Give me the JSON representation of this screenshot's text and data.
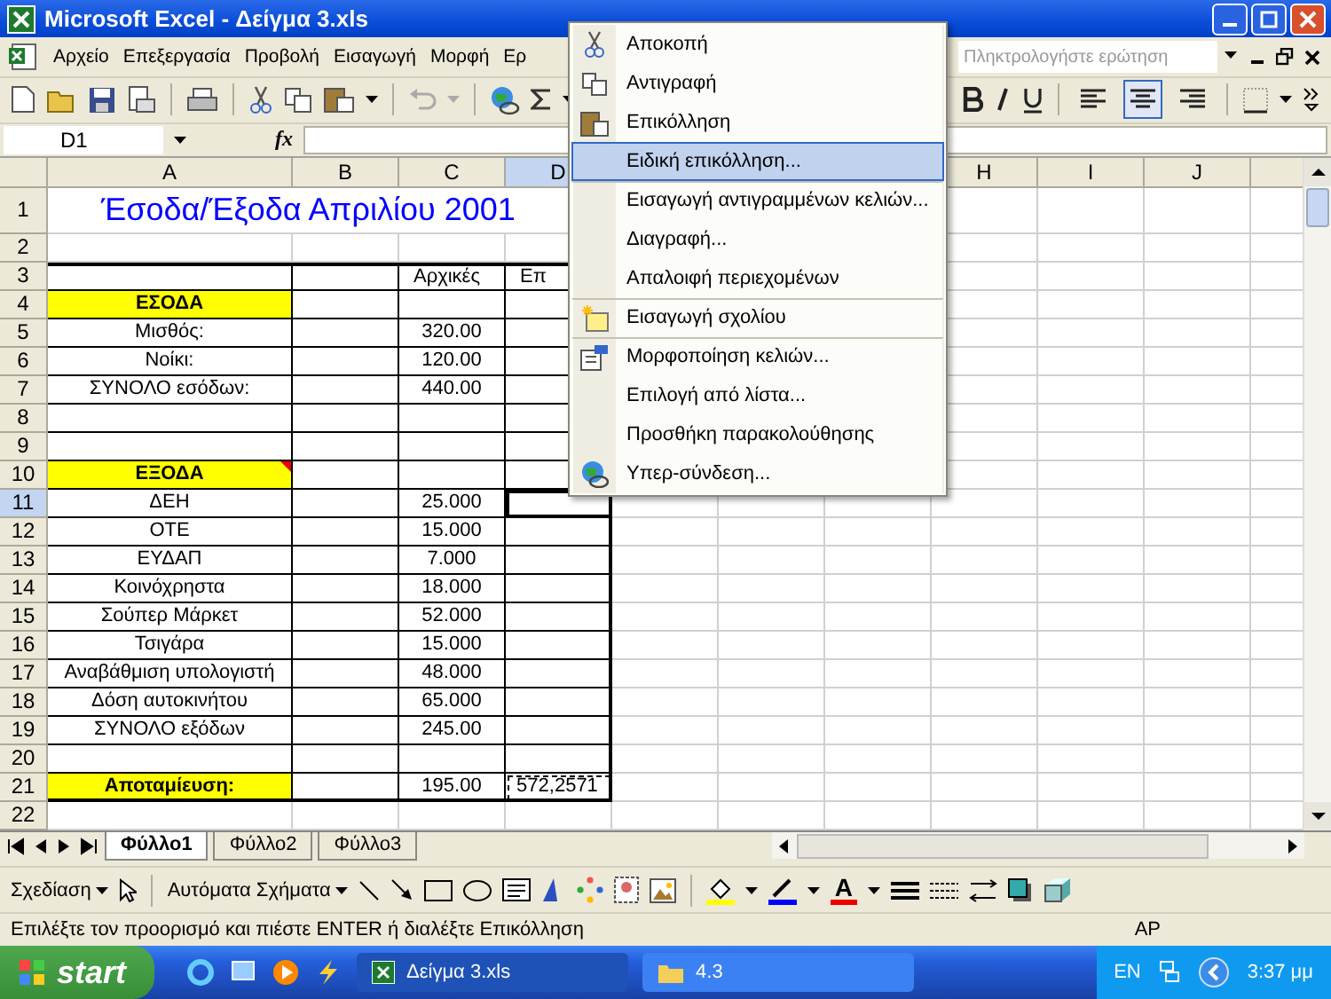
{
  "window": {
    "title": "Microsoft Excel - Δείγμα 3.xls"
  },
  "menu_bar": {
    "items": [
      "Αρχείο",
      "Επεξεργασία",
      "Προβολή",
      "Εισαγωγή",
      "Μορφή",
      "Ερ"
    ],
    "ask_box": {
      "placeholder": "Πληκτρολογήστε ερώτηση"
    }
  },
  "standard_toolbar": {
    "undo": {
      "disabled": true
    }
  },
  "formatting_toolbar": {
    "align": [
      {
        "selected": false
      },
      {
        "selected": true
      },
      {
        "selected": false
      }
    ]
  },
  "formula_bar": {
    "name_box": "D1",
    "function_label": "fx"
  },
  "grid": {
    "columns": [
      {
        "label": "A",
        "selected": false
      },
      {
        "label": "B",
        "selected": false
      },
      {
        "label": "C",
        "selected": false
      },
      {
        "label": "D",
        "selected": true
      },
      {
        "label": "H",
        "selected": false
      },
      {
        "label": "I",
        "selected": false
      },
      {
        "label": "J",
        "selected": false
      }
    ],
    "rows": [
      {
        "number": "1",
        "kind": "title",
        "selected": false,
        "cells": [
          {
            "text": "Έσοδα/Έξοδα Απριλίου 2001",
            "kind": "title"
          }
        ]
      },
      {
        "number": "2",
        "kind": "blank",
        "selected": false,
        "cells": []
      },
      {
        "number": "3",
        "kind": "table_head",
        "selected": false,
        "cells": [
          {
            "kind": "empty"
          },
          {
            "kind": "empty"
          },
          {
            "text": "Αρχικές",
            "kind": "text"
          },
          {
            "text": "Επ",
            "kind": "text"
          }
        ]
      },
      {
        "number": "4",
        "kind": "table",
        "selected": false,
        "cells": [
          {
            "text": "ΕΣΟΔΑ",
            "kind": "heading"
          },
          {
            "kind": "empty"
          },
          {
            "kind": "empty"
          },
          {
            "kind": "empty"
          }
        ]
      },
      {
        "number": "5",
        "kind": "table",
        "selected": false,
        "cells": [
          {
            "text": "Μισθός:",
            "kind": "label"
          },
          {
            "kind": "empty"
          },
          {
            "text": "320.00",
            "kind": "number"
          },
          {
            "kind": "empty"
          }
        ]
      },
      {
        "number": "6",
        "kind": "table",
        "selected": false,
        "cells": [
          {
            "text": "Νοίκι:",
            "kind": "label"
          },
          {
            "kind": "empty"
          },
          {
            "text": "120.00",
            "kind": "number"
          },
          {
            "kind": "empty"
          }
        ]
      },
      {
        "number": "7",
        "kind": "table",
        "selected": false,
        "cells": [
          {
            "text": "ΣΥΝΟΛΟ εσόδων:",
            "kind": "label"
          },
          {
            "kind": "empty"
          },
          {
            "text": "440.00",
            "kind": "number"
          },
          {
            "kind": "empty"
          }
        ]
      },
      {
        "number": "8",
        "kind": "table",
        "selected": false,
        "cells": [
          {
            "kind": "empty"
          },
          {
            "kind": "empty"
          },
          {
            "kind": "empty"
          },
          {
            "kind": "empty"
          }
        ]
      },
      {
        "number": "9",
        "kind": "table",
        "selected": false,
        "cells": [
          {
            "kind": "empty"
          },
          {
            "kind": "empty"
          },
          {
            "kind": "empty"
          },
          {
            "kind": "empty"
          }
        ]
      },
      {
        "number": "10",
        "kind": "table",
        "selected": false,
        "cells": [
          {
            "text": "ΕΞΟΔΑ",
            "kind": "heading_note"
          },
          {
            "kind": "empty"
          },
          {
            "kind": "empty"
          },
          {
            "kind": "empty"
          }
        ]
      },
      {
        "number": "11",
        "kind": "table",
        "selected": true,
        "cells": [
          {
            "text": "ΔΕΗ",
            "kind": "label"
          },
          {
            "kind": "empty"
          },
          {
            "text": "25.000",
            "kind": "number"
          },
          {
            "kind": "empty"
          }
        ]
      },
      {
        "number": "12",
        "kind": "table",
        "selected": false,
        "cells": [
          {
            "text": "ΟΤΕ",
            "kind": "label"
          },
          {
            "kind": "empty"
          },
          {
            "text": "15.000",
            "kind": "number"
          },
          {
            "kind": "empty"
          }
        ]
      },
      {
        "number": "13",
        "kind": "table",
        "selected": false,
        "cells": [
          {
            "text": "ΕΥΔΑΠ",
            "kind": "label"
          },
          {
            "kind": "empty"
          },
          {
            "text": "7.000",
            "kind": "number"
          },
          {
            "kind": "empty"
          }
        ]
      },
      {
        "number": "14",
        "kind": "table",
        "selected": false,
        "cells": [
          {
            "text": "Κοινόχρηστα",
            "kind": "label"
          },
          {
            "kind": "empty"
          },
          {
            "text": "18.000",
            "kind": "number"
          },
          {
            "kind": "empty"
          }
        ]
      },
      {
        "number": "15",
        "kind": "table",
        "selected": false,
        "cells": [
          {
            "text": "Σούπερ Μάρκετ",
            "kind": "label"
          },
          {
            "kind": "empty"
          },
          {
            "text": "52.000",
            "kind": "number"
          },
          {
            "kind": "empty"
          }
        ]
      },
      {
        "number": "16",
        "kind": "table",
        "selected": false,
        "cells": [
          {
            "text": "Τσιγάρα",
            "kind": "label"
          },
          {
            "kind": "empty"
          },
          {
            "text": "15.000",
            "kind": "number"
          },
          {
            "kind": "empty"
          }
        ]
      },
      {
        "number": "17",
        "kind": "table",
        "selected": false,
        "cells": [
          {
            "text": "Αναβάθμιση υπολογιστή",
            "kind": "label"
          },
          {
            "kind": "empty"
          },
          {
            "text": "48.000",
            "kind": "number"
          },
          {
            "kind": "empty"
          }
        ]
      },
      {
        "number": "18",
        "kind": "table",
        "selected": false,
        "cells": [
          {
            "text": "Δόση αυτοκινήτου",
            "kind": "label"
          },
          {
            "kind": "empty"
          },
          {
            "text": "65.000",
            "kind": "number"
          },
          {
            "kind": "empty"
          }
        ]
      },
      {
        "number": "19",
        "kind": "table",
        "selected": false,
        "cells": [
          {
            "text": "ΣΥΝΟΛΟ εξόδων",
            "kind": "label"
          },
          {
            "kind": "empty"
          },
          {
            "text": "245.00",
            "kind": "number"
          },
          {
            "kind": "empty"
          }
        ]
      },
      {
        "number": "20",
        "kind": "table",
        "selected": false,
        "cells": [
          {
            "kind": "empty"
          },
          {
            "kind": "empty"
          },
          {
            "kind": "empty"
          },
          {
            "kind": "empty"
          }
        ]
      },
      {
        "number": "21",
        "kind": "total",
        "selected": false,
        "cells": [
          {
            "text": "Αποταμίευση:",
            "kind": "heading"
          },
          {
            "kind": "empty"
          },
          {
            "text": "195.00",
            "kind": "number"
          },
          {
            "text": "572,2571",
            "kind": "copied"
          }
        ]
      },
      {
        "number": "22",
        "kind": "blank",
        "selected": false,
        "cells": []
      }
    ]
  },
  "context_menu": {
    "items": [
      {
        "label": "Αποκοπή",
        "selected": false,
        "separator": false
      },
      {
        "label": "Αντιγραφή",
        "selected": false,
        "separator": false
      },
      {
        "label": "Επικόλληση",
        "selected": false,
        "separator": false
      },
      {
        "label": "Ειδική επικόλληση...",
        "selected": true,
        "separator": false
      },
      {
        "label": "Εισαγωγή αντιγραμμένων κελιών...",
        "selected": false,
        "separator": true
      },
      {
        "label": "Διαγραφή...",
        "selected": false,
        "separator": false
      },
      {
        "label": "Απαλοιφή περιεχομένων",
        "selected": false,
        "separator": false
      },
      {
        "label": "Εισαγωγή σχολίου",
        "selected": false,
        "separator": true
      },
      {
        "label": "Μορφοποίηση κελιών...",
        "selected": false,
        "separator": true
      },
      {
        "label": "Επιλογή από λίστα...",
        "selected": false,
        "separator": false
      },
      {
        "label": "Προσθήκη παρακολούθησης",
        "selected": false,
        "separator": false
      },
      {
        "label": "Υπερ-σύνδεση...",
        "selected": false,
        "separator": false
      }
    ]
  },
  "sheet_tabs": [
    {
      "label": "Φύλλο1",
      "selected": true
    },
    {
      "label": "Φύλλο2",
      "selected": false
    },
    {
      "label": "Φύλλο3",
      "selected": false
    }
  ],
  "drawing_toolbar": {
    "draw_menu": "Σχεδίαση",
    "autoshapes_menu": "Αυτόματα Σχήματα",
    "font_color_label": "A"
  },
  "status_bar": {
    "message": "Επιλέξτε τον προορισμό και πιέστε ENTER ή διαλέξτε Επικόλληση",
    "indicator": "ΑΡ"
  },
  "taskbar": {
    "start": "start",
    "tasks": [
      {
        "label": "Δείγμα 3.xls",
        "selected": true
      },
      {
        "label": "4.3",
        "selected": false
      }
    ],
    "language": "EN",
    "clock": "3:37 μμ"
  }
}
